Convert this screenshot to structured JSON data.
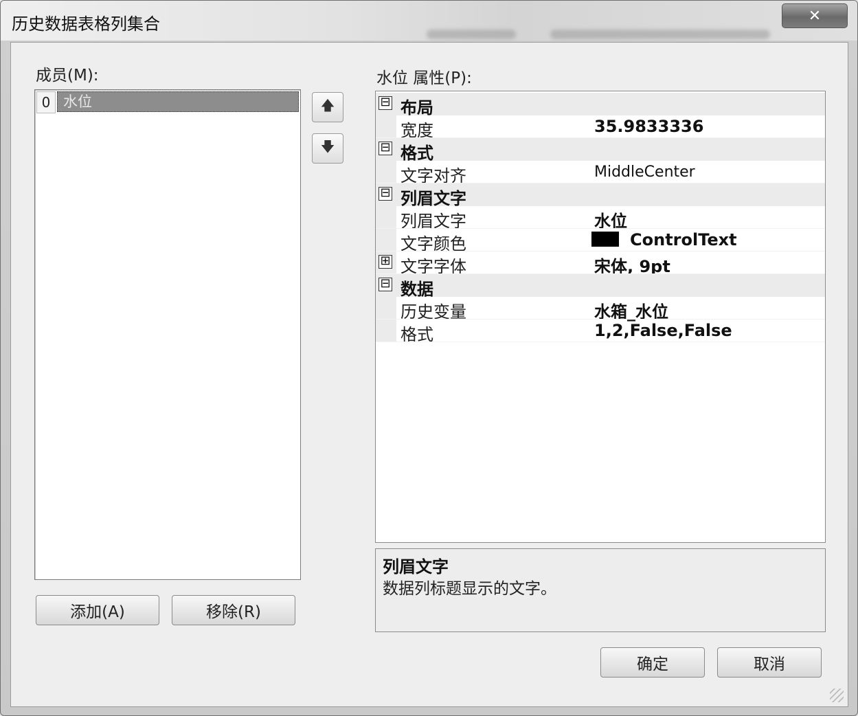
{
  "window": {
    "title": "历史数据表格列集合",
    "close_label": "✕"
  },
  "members": {
    "label": "成员(M):",
    "items": [
      {
        "index": "0",
        "name": "水位"
      }
    ],
    "up_icon": "arrow-up-icon",
    "down_icon": "arrow-down-icon",
    "add_label": "添加(A)",
    "remove_label": "移除(R)"
  },
  "properties": {
    "label": "水位 属性(P):",
    "categories": [
      {
        "name": "布局",
        "expander": "⊟",
        "rows": [
          {
            "name": "宽度",
            "value": "35.9833336",
            "bold": true
          }
        ]
      },
      {
        "name": "格式",
        "expander": "⊟",
        "rows": [
          {
            "name": "文字对齐",
            "value": "MiddleCenter",
            "bold": false
          }
        ]
      },
      {
        "name": "列眉文字",
        "expander": "⊟",
        "rows": [
          {
            "name": "列眉文字",
            "value": "水位",
            "bold": true
          },
          {
            "name": "文字颜色",
            "value": "ControlText",
            "bold": true,
            "swatch": "#000000"
          },
          {
            "name": "文字字体",
            "value": "宋体, 9pt",
            "bold": true,
            "expander": "⊞"
          }
        ]
      },
      {
        "name": "数据",
        "expander": "⊟",
        "rows": [
          {
            "name": "历史变量",
            "value": "水箱_水位",
            "bold": true
          },
          {
            "name": "格式",
            "value": "1,2,False,False",
            "bold": true
          }
        ]
      }
    ]
  },
  "description": {
    "title": "列眉文字",
    "text": "数据列标题显示的文字。"
  },
  "buttons": {
    "ok_label": "确定",
    "cancel_label": "取消"
  }
}
